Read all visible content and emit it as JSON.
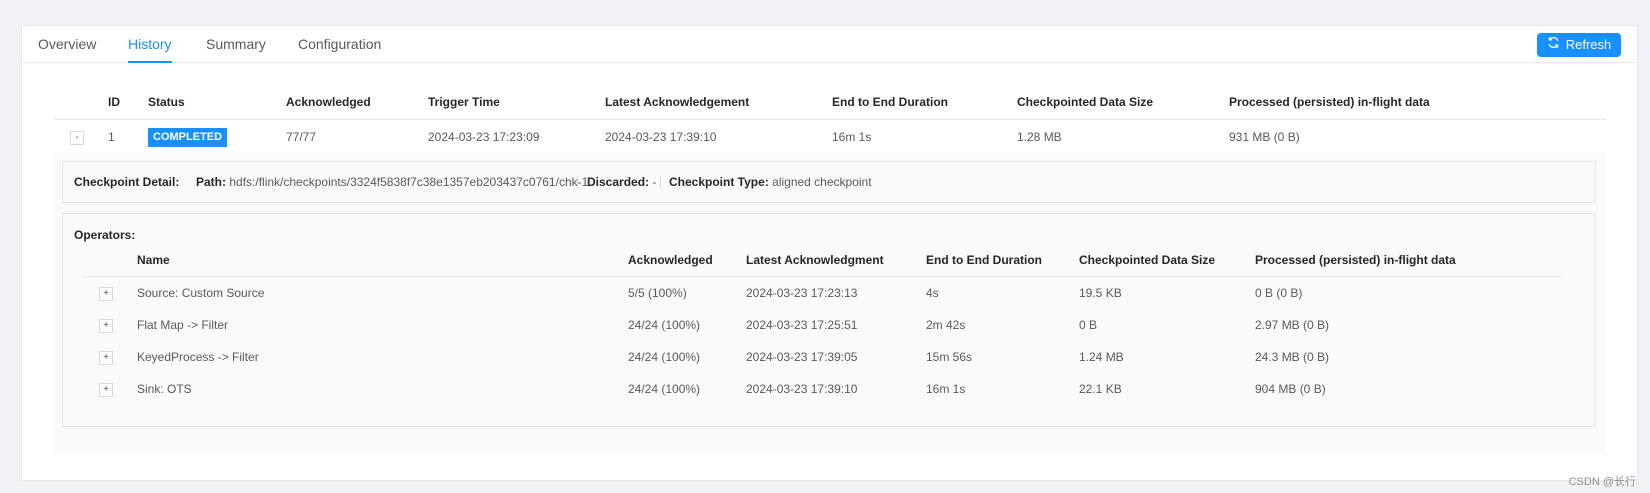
{
  "tabs": [
    {
      "label": "Overview",
      "active": false
    },
    {
      "label": "History",
      "active": true
    },
    {
      "label": "Summary",
      "active": false
    },
    {
      "label": "Configuration",
      "active": false
    }
  ],
  "refresh_label": "Refresh",
  "checkpoint_table": {
    "headers": [
      "ID",
      "Status",
      "Acknowledged",
      "Trigger Time",
      "Latest Acknowledgement",
      "End to End Duration",
      "Checkpointed Data Size",
      "Processed (persisted) in-flight data"
    ],
    "row": {
      "toggle": "-",
      "id": "1",
      "status": "COMPLETED",
      "acknowledged": "77/77",
      "trigger_time": "2024-03-23 17:23:09",
      "latest_ack": "2024-03-23 17:39:10",
      "duration": "16m 1s",
      "data_size": "1.28 MB",
      "inflight": "931 MB (0 B)"
    }
  },
  "detail": {
    "title": "Checkpoint Detail:",
    "path_label": "Path:",
    "path_value": "hdfs:/flink/checkpoints/3324f5838f7c38e1357eb203437c0761/chk-1",
    "discarded_label": "Discarded:",
    "discarded_value": "-",
    "type_label": "Checkpoint Type:",
    "type_value": "aligned checkpoint"
  },
  "operators": {
    "title": "Operators:",
    "headers": [
      "Name",
      "Acknowledged",
      "Latest Acknowledgment",
      "End to End Duration",
      "Checkpointed Data Size",
      "Processed (persisted) in-flight data"
    ],
    "rows": [
      {
        "toggle": "+",
        "name": "Source: Custom Source",
        "ack": "5/5 (100%)",
        "latest": "2024-03-23 17:23:13",
        "duration": "4s",
        "size": "19.5 KB",
        "inflight": "0 B (0 B)"
      },
      {
        "toggle": "+",
        "name": "Flat Map -> Filter",
        "ack": "24/24 (100%)",
        "latest": "2024-03-23 17:25:51",
        "duration": "2m 42s",
        "size": "0 B",
        "inflight": "2.97 MB (0 B)"
      },
      {
        "toggle": "+",
        "name": "KeyedProcess -> Filter",
        "ack": "24/24 (100%)",
        "latest": "2024-03-23 17:39:05",
        "duration": "15m 56s",
        "size": "1.24 MB",
        "inflight": "24.3 MB (0 B)"
      },
      {
        "toggle": "+",
        "name": "Sink: OTS",
        "ack": "24/24 (100%)",
        "latest": "2024-03-23 17:39:10",
        "duration": "16m 1s",
        "size": "22.1 KB",
        "inflight": "904 MB (0 B)"
      }
    ]
  },
  "watermark": "CSDN @长行",
  "colors": {
    "accent": "#1890ff",
    "background": "#f0f2f5",
    "border": "#e8e8e8"
  }
}
